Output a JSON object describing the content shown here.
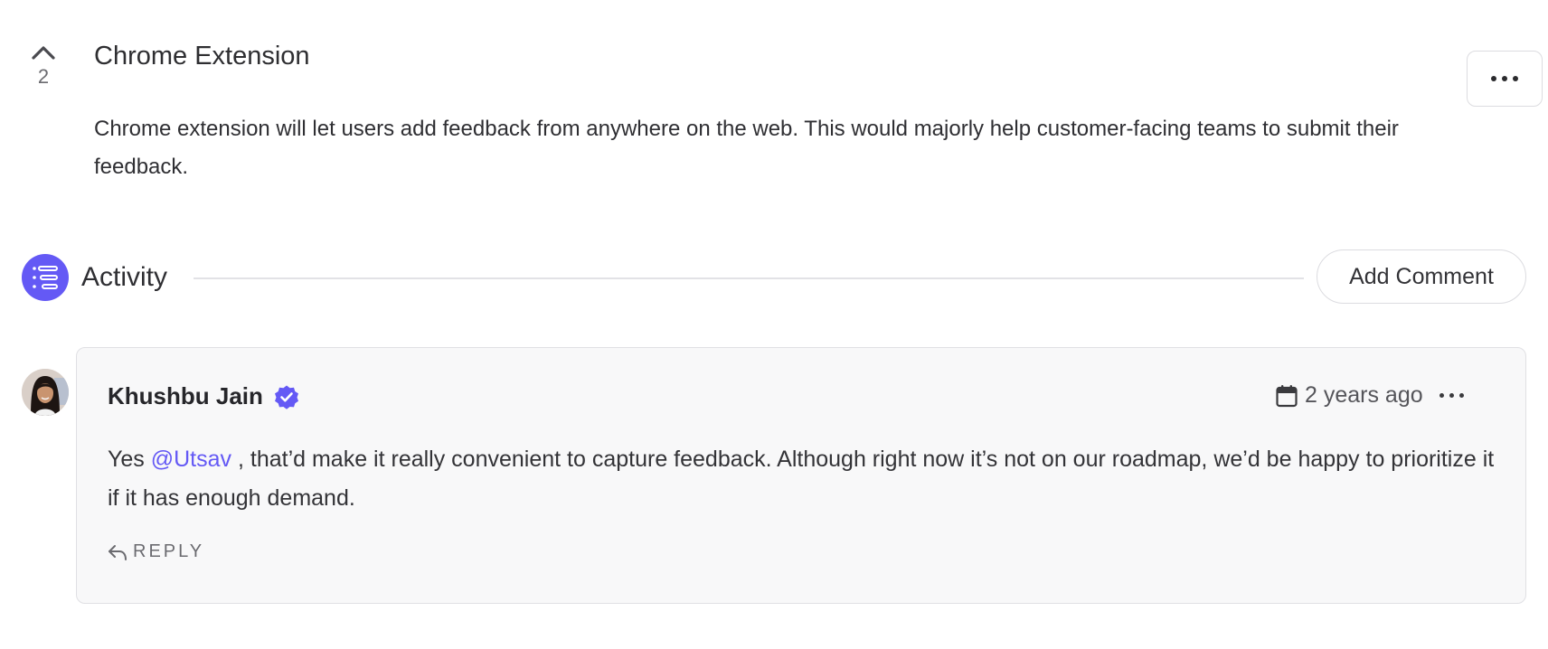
{
  "post": {
    "vote_count": "2",
    "title": "Chrome Extension",
    "description": "Chrome extension will let users add feedback from anywhere on the web. This would majorly help customer-facing teams to submit their feedback."
  },
  "activity": {
    "title": "Activity",
    "add_comment_label": "Add Comment",
    "accent_color": "#6459f5"
  },
  "comment": {
    "author": "Khushbu Jain",
    "verified": true,
    "timestamp": "2 years ago",
    "text_before": "Yes ",
    "mention": "@Utsav",
    "text_after": " , that’d make it really convenient to capture feedback. Although right now it’s not on our roadmap, we’d be happy to prioritize it if it has enough demand.",
    "reply_label": "REPLY"
  },
  "icons": {
    "upvote": "chevron-up-icon",
    "more": "more-horizontal-icon",
    "activity": "list-icon",
    "verified": "verified-badge-icon",
    "calendar": "calendar-icon",
    "reply": "reply-arrow-icon"
  }
}
